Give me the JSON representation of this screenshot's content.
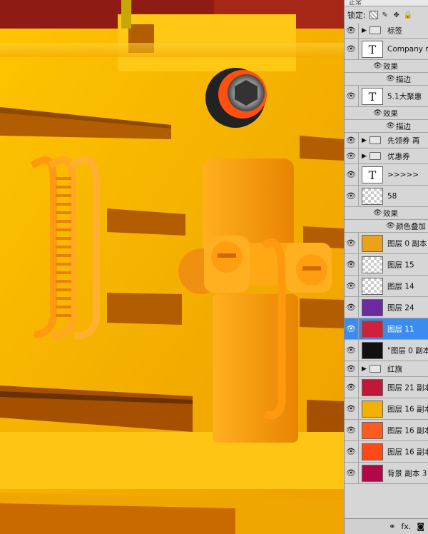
{
  "blend_mode": "正常",
  "lock": {
    "label": "锁定:",
    "icons": [
      "lock-transparent-icon",
      "lock-brush-icon",
      "lock-move-icon",
      "lock-all-icon"
    ]
  },
  "layers": [
    {
      "kind": "group",
      "name": "标签"
    },
    {
      "kind": "text",
      "name": "Company na"
    },
    {
      "kind": "fx",
      "name": "效果"
    },
    {
      "kind": "sub",
      "name": "描边"
    },
    {
      "kind": "text",
      "name": "5.1大聚惠"
    },
    {
      "kind": "fx",
      "name": "效果"
    },
    {
      "kind": "sub",
      "name": "描边"
    },
    {
      "kind": "group",
      "name": "先领券 再"
    },
    {
      "kind": "group",
      "name": "优惠券"
    },
    {
      "kind": "text",
      "name": ">>>>>"
    },
    {
      "kind": "pixel",
      "name": "58",
      "thumb": "checker"
    },
    {
      "kind": "fx",
      "name": "效果"
    },
    {
      "kind": "sub",
      "name": "颜色叠加"
    },
    {
      "kind": "pixel",
      "name": "图层 0 副本",
      "thumb": "#e9a21a"
    },
    {
      "kind": "pixel",
      "name": "图层 15",
      "thumb": "checker"
    },
    {
      "kind": "pixel",
      "name": "图层 14",
      "thumb": "checker"
    },
    {
      "kind": "pixel",
      "name": "图层 24",
      "thumb": "#6a2aa0"
    },
    {
      "kind": "pixel",
      "name": "图层 11",
      "thumb": "#d0203a",
      "selected": true
    },
    {
      "kind": "pixel",
      "name": "\"图层 0 副本",
      "thumb": "#111111"
    },
    {
      "kind": "group",
      "name": "红旗"
    },
    {
      "kind": "pixel",
      "name": "图层 21 副本",
      "thumb": "#c01838"
    },
    {
      "kind": "pixel",
      "name": "图层 16 副本",
      "thumb": "#f2b000"
    },
    {
      "kind": "pixel",
      "name": "图层 16 副本",
      "thumb": "#ff5a20"
    },
    {
      "kind": "pixel",
      "name": "图层 16 副本",
      "thumb": "#ff4a18"
    },
    {
      "kind": "pixel",
      "name": "背景 副本 3",
      "thumb": "#b00848"
    }
  ],
  "bottom_icons": [
    "link-icon",
    "fx-icon",
    "mask-icon"
  ],
  "bottom_labels": {
    "fx": "fx."
  },
  "colors": {
    "canvas_base": "#f2b400",
    "canvas_dark": "#b25d00",
    "canvas_top": "#8f1c14",
    "selection": "#3c8cf0",
    "panel": "#d6d6d6"
  }
}
